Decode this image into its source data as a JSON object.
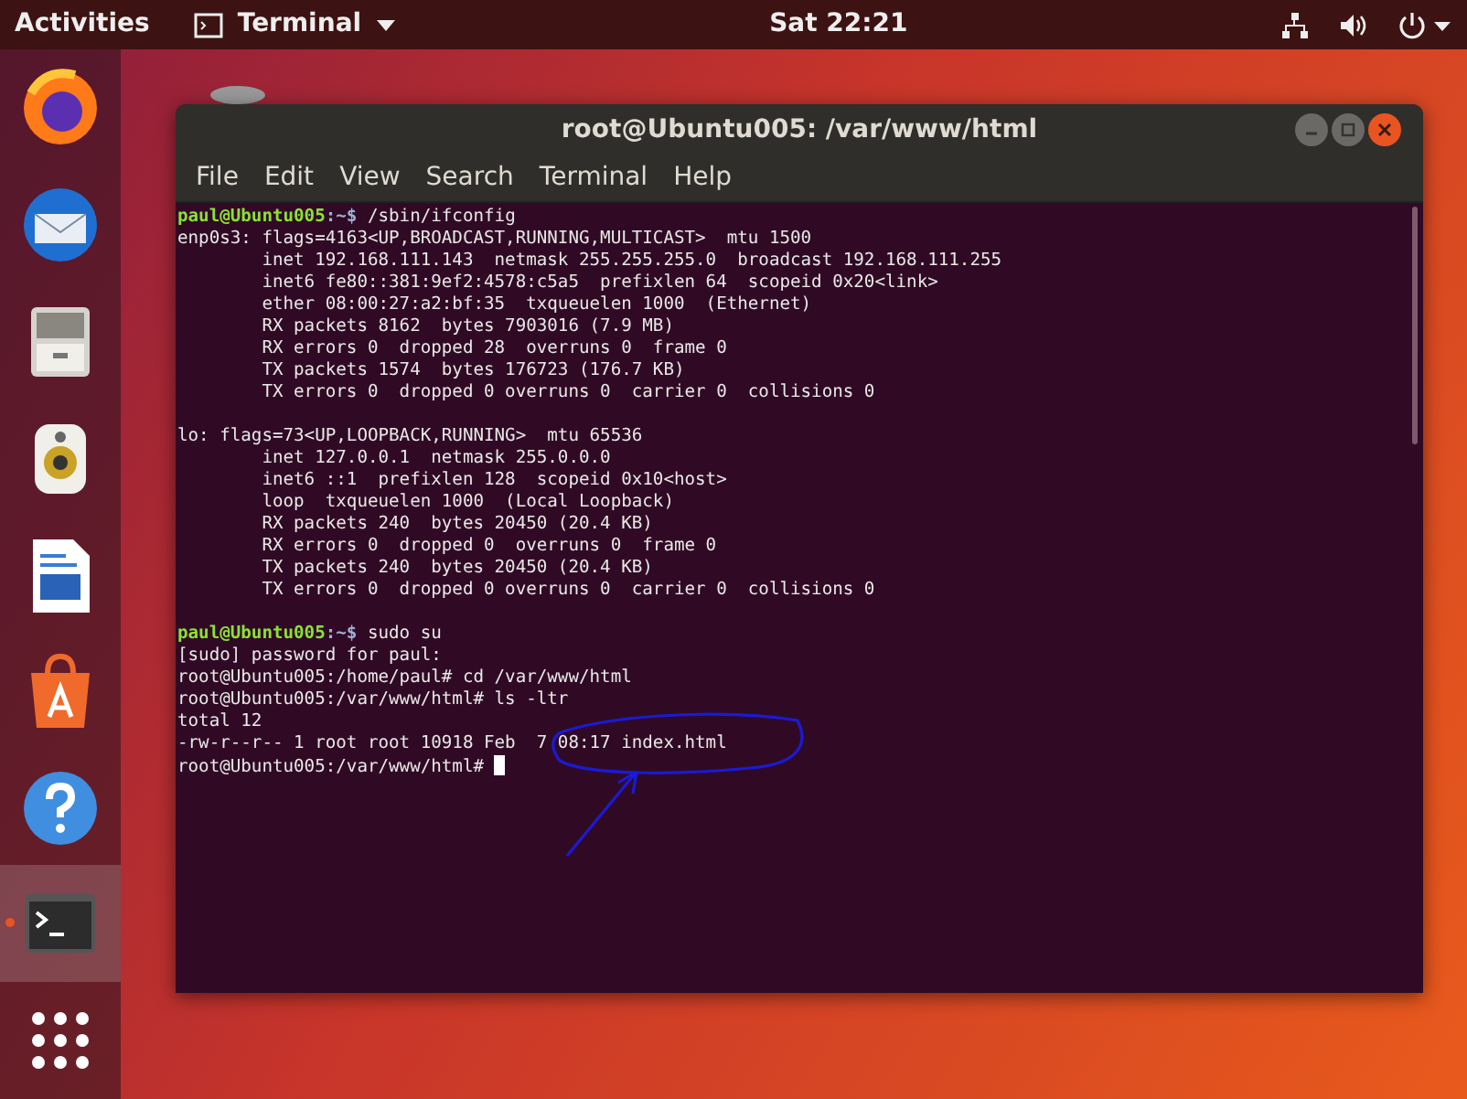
{
  "top_bar": {
    "activities": "Activities",
    "app_menu": "Terminal",
    "clock": "Sat 22:21"
  },
  "dock": [
    {
      "kind": "browser",
      "selected": false,
      "running": false
    },
    {
      "kind": "mail",
      "selected": false,
      "running": false
    },
    {
      "kind": "files",
      "selected": false,
      "running": false
    },
    {
      "kind": "music",
      "selected": false,
      "running": false
    },
    {
      "kind": "document",
      "selected": false,
      "running": false
    },
    {
      "kind": "store",
      "selected": false,
      "running": false
    },
    {
      "kind": "help",
      "selected": false,
      "running": false
    },
    {
      "kind": "terminal",
      "selected": true,
      "running": true
    },
    {
      "kind": "apps",
      "selected": false,
      "running": false
    }
  ],
  "window": {
    "title": "root@Ubuntu005: /var/www/html",
    "menu": [
      "File",
      "Edit",
      "View",
      "Search",
      "Terminal",
      "Help"
    ],
    "lines": [
      {
        "kind": "prompt",
        "user": "paul@Ubuntu005",
        "path": ":~$",
        "command": " /sbin/ifconfig"
      },
      {
        "kind": "output",
        "text": "enp0s3: flags=4163<UP,BROADCAST,RUNNING,MULTICAST>  mtu 1500"
      },
      {
        "kind": "output",
        "text": "        inet 192.168.111.143  netmask 255.255.255.0  broadcast 192.168.111.255"
      },
      {
        "kind": "output",
        "text": "        inet6 fe80::381:9ef2:4578:c5a5  prefixlen 64  scopeid 0x20<link>"
      },
      {
        "kind": "output",
        "text": "        ether 08:00:27:a2:bf:35  txqueuelen 1000  (Ethernet)"
      },
      {
        "kind": "output",
        "text": "        RX packets 8162  bytes 7903016 (7.9 MB)"
      },
      {
        "kind": "output",
        "text": "        RX errors 0  dropped 28  overruns 0  frame 0"
      },
      {
        "kind": "output",
        "text": "        TX packets 1574  bytes 176723 (176.7 KB)"
      },
      {
        "kind": "output",
        "text": "        TX errors 0  dropped 0 overruns 0  carrier 0  collisions 0"
      },
      {
        "kind": "blank"
      },
      {
        "kind": "output",
        "text": "lo: flags=73<UP,LOOPBACK,RUNNING>  mtu 65536"
      },
      {
        "kind": "output",
        "text": "        inet 127.0.0.1  netmask 255.0.0.0"
      },
      {
        "kind": "output",
        "text": "        inet6 ::1  prefixlen 128  scopeid 0x10<host>"
      },
      {
        "kind": "output",
        "text": "        loop  txqueuelen 1000  (Local Loopback)"
      },
      {
        "kind": "output",
        "text": "        RX packets 240  bytes 20450 (20.4 KB)"
      },
      {
        "kind": "output",
        "text": "        RX errors 0  dropped 0  overruns 0  frame 0"
      },
      {
        "kind": "output",
        "text": "        TX packets 240  bytes 20450 (20.4 KB)"
      },
      {
        "kind": "output",
        "text": "        TX errors 0  dropped 0 overruns 0  carrier 0  collisions 0"
      },
      {
        "kind": "blank"
      },
      {
        "kind": "prompt",
        "user": "paul@Ubuntu005",
        "path": ":~$",
        "command": " sudo su"
      },
      {
        "kind": "output",
        "text": "[sudo] password for paul:"
      },
      {
        "kind": "output",
        "text": "root@Ubuntu005:/home/paul# cd /var/www/html"
      },
      {
        "kind": "output",
        "text": "root@Ubuntu005:/var/www/html# ls -ltr"
      },
      {
        "kind": "output",
        "text": "total 12"
      },
      {
        "kind": "output",
        "text": "-rw-r--r-- 1 root root 10918 Feb  7 08:17 index.html"
      },
      {
        "kind": "output",
        "text": "root@Ubuntu005:/var/www/html# ",
        "cursor": true
      }
    ]
  }
}
